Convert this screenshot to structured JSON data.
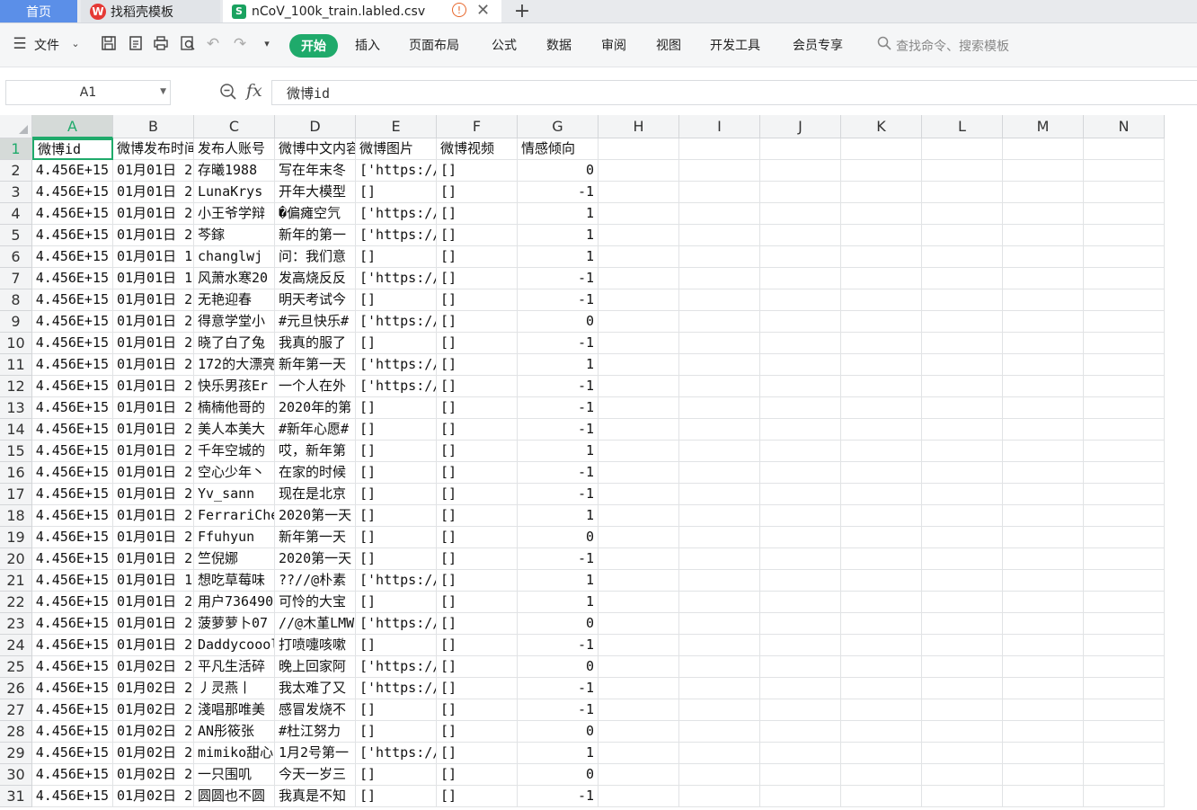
{
  "tabs": {
    "home": "首页",
    "template": "找稻壳模板",
    "file": "nCoV_100k_train.labled.csv",
    "template_icon": "W",
    "file_icon": "S",
    "warn_icon": "!",
    "close_icon": "✕",
    "add_icon": "+"
  },
  "ribbon": {
    "file_menu": "文件",
    "start": "开始",
    "menus": [
      "插入",
      "页面布局",
      "公式",
      "数据",
      "审阅",
      "视图",
      "开发工具",
      "会员专享"
    ],
    "search_placeholder": "查找命令、搜索模板"
  },
  "formula_bar": {
    "cell_ref": "A1",
    "fx": "fx",
    "content": "微博id"
  },
  "sheet": {
    "columns": [
      "A",
      "B",
      "C",
      "D",
      "E",
      "F",
      "G",
      "H",
      "I",
      "J",
      "K",
      "L",
      "M",
      "N"
    ],
    "rows": [
      [
        "微博id",
        "微博发布时间",
        "发布人账号",
        "微博中文内容",
        "微博图片",
        "微博视频",
        "情感倾向"
      ],
      [
        "4.456E+15",
        "01月01日 2",
        "存曦1988",
        "写在年末冬",
        "['https://",
        "[]",
        "0"
      ],
      [
        "4.456E+15",
        "01月01日 2",
        "LunaKrys",
        "开年大模型",
        "[]",
        "[]",
        "-1"
      ],
      [
        "4.456E+15",
        "01月01日 2",
        "小王爷学辩",
        "�偏瘫空氕",
        "['https://",
        "[]",
        "1"
      ],
      [
        "4.456E+15",
        "01月01日 2",
        "芩鎵",
        "新年的第一",
        "['https://",
        "[]",
        "1"
      ],
      [
        "4.456E+15",
        "01月01日 1",
        "changlwj",
        "问：我们意",
        "[]",
        "[]",
        "1"
      ],
      [
        "4.456E+15",
        "01月01日 1",
        "风萧水寒20",
        "发高烧反反",
        "['https://",
        "[]",
        "-1"
      ],
      [
        "4.456E+15",
        "01月01日 2",
        "无艳迎春",
        "明天考试今",
        "[]",
        "[]",
        "-1"
      ],
      [
        "4.456E+15",
        "01月01日 2",
        "得意学堂小",
        "#元旦快乐#",
        "['https://",
        "[]",
        "0"
      ],
      [
        "4.456E+15",
        "01月01日 2",
        "晓了白了兔",
        "我真的服了",
        "[]",
        "[]",
        "-1"
      ],
      [
        "4.456E+15",
        "01月01日 2",
        "172的大漂亮",
        "新年第一天",
        "['https://",
        "[]",
        "1"
      ],
      [
        "4.456E+15",
        "01月01日 2",
        "快乐男孩Er",
        "一个人在外",
        "['https://",
        "[]",
        "-1"
      ],
      [
        "4.456E+15",
        "01月01日 2",
        "楠楠他哥的",
        "2020年的第",
        "[]",
        "[]",
        "-1"
      ],
      [
        "4.456E+15",
        "01月01日 2",
        "美人本美大",
        "#新年心愿#",
        "[]",
        "[]",
        "-1"
      ],
      [
        "4.456E+15",
        "01月01日 2",
        "千年空城的",
        "哎，新年第",
        "[]",
        "[]",
        "1"
      ],
      [
        "4.456E+15",
        "01月01日 2",
        "空心少年丶",
        "在家的时候",
        "[]",
        "[]",
        "-1"
      ],
      [
        "4.456E+15",
        "01月01日 2",
        "Yv_sann",
        "现在是北京",
        "[]",
        "[]",
        "-1"
      ],
      [
        "4.456E+15",
        "01月01日 2",
        "FerrariChe",
        "2020第一天",
        "[]",
        "[]",
        "1"
      ],
      [
        "4.456E+15",
        "01月01日 2",
        "Ffuhyun",
        "新年第一天",
        "[]",
        "[]",
        "0"
      ],
      [
        "4.456E+15",
        "01月01日 2",
        "竺倪娜",
        "2020第一天",
        "[]",
        "[]",
        "-1"
      ],
      [
        "4.456E+15",
        "01月01日 1",
        "想吃草莓味",
        "??//@朴素",
        "['https://",
        "[]",
        "1"
      ],
      [
        "4.456E+15",
        "01月01日 2",
        "用户736490",
        "可怜的大宝",
        "[]",
        "[]",
        "1"
      ],
      [
        "4.456E+15",
        "01月01日 2",
        "菠萝萝卜07",
        "//@木堇LMW",
        "['https://",
        "[]",
        "0"
      ],
      [
        "4.456E+15",
        "01月01日 2",
        "Daddycoool",
        "打喷嚏咳嗽",
        "[]",
        "[]",
        "-1"
      ],
      [
        "4.456E+15",
        "01月02日 2",
        "平凡生活碎",
        "晚上回家阿",
        "['https://",
        "[]",
        "0"
      ],
      [
        "4.456E+15",
        "01月02日 2",
        "丿灵燕丨",
        "我太难了又",
        "['https://",
        "[]",
        "-1"
      ],
      [
        "4.456E+15",
        "01月02日 2",
        "淺唱那唯美",
        "感冒发烧不",
        "[]",
        "[]",
        "-1"
      ],
      [
        "4.456E+15",
        "01月02日 2",
        "AN彤筱张",
        "#杜江努力",
        "[]",
        "[]",
        "0"
      ],
      [
        "4.456E+15",
        "01月02日 2",
        "mimiko甜心",
        "1月2号第一",
        "['https://",
        "[]",
        "1"
      ],
      [
        "4.456E+15",
        "01月02日 2",
        "一只围叽",
        "今天一岁三",
        "[]",
        "[]",
        "0"
      ],
      [
        "4.456E+15",
        "01月02日 2",
        "圆圆也不圆",
        "我真是不知",
        "[]",
        "[]",
        "-1"
      ]
    ]
  }
}
